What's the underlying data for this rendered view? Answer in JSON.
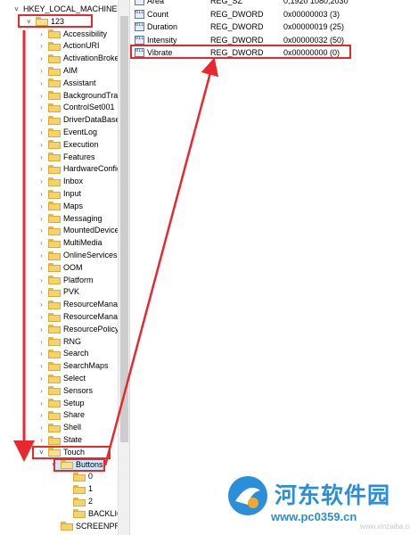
{
  "tree": {
    "root_label": "HKEY_LOCAL_MACHINE",
    "items": [
      {
        "label": "123",
        "depth": 1,
        "expanded": true
      },
      {
        "label": "Accessibility",
        "depth": 2
      },
      {
        "label": "ActionURI",
        "depth": 2
      },
      {
        "label": "ActivationBroker",
        "depth": 2
      },
      {
        "label": "AIM",
        "depth": 2
      },
      {
        "label": "Assistant",
        "depth": 2
      },
      {
        "label": "BackgroundTran",
        "depth": 2
      },
      {
        "label": "ControlSet001",
        "depth": 2
      },
      {
        "label": "DriverDataBase",
        "depth": 2
      },
      {
        "label": "EventLog",
        "depth": 2
      },
      {
        "label": "Execution",
        "depth": 2
      },
      {
        "label": "Features",
        "depth": 2
      },
      {
        "label": "HardwareConfig",
        "depth": 2
      },
      {
        "label": "Inbox",
        "depth": 2
      },
      {
        "label": "Input",
        "depth": 2
      },
      {
        "label": "Maps",
        "depth": 2
      },
      {
        "label": "Messaging",
        "depth": 2
      },
      {
        "label": "MountedDevices",
        "depth": 2
      },
      {
        "label": "MultiMedia",
        "depth": 2
      },
      {
        "label": "OnlineServices",
        "depth": 2
      },
      {
        "label": "OOM",
        "depth": 2
      },
      {
        "label": "Platform",
        "depth": 2
      },
      {
        "label": "PVK",
        "depth": 2
      },
      {
        "label": "ResourceManag",
        "depth": 2
      },
      {
        "label": "ResourceManag",
        "depth": 2
      },
      {
        "label": "ResourcePolicyS",
        "depth": 2
      },
      {
        "label": "RNG",
        "depth": 2
      },
      {
        "label": "Search",
        "depth": 2
      },
      {
        "label": "SearchMaps",
        "depth": 2
      },
      {
        "label": "Select",
        "depth": 2
      },
      {
        "label": "Sensors",
        "depth": 2
      },
      {
        "label": "Setup",
        "depth": 2
      },
      {
        "label": "Share",
        "depth": 2
      },
      {
        "label": "Shell",
        "depth": 2
      },
      {
        "label": "State",
        "depth": 2
      },
      {
        "label": "Touch",
        "depth": 2,
        "expanded": true
      },
      {
        "label": "Buttons",
        "depth": 3,
        "expanded": true,
        "selected": true
      },
      {
        "label": "0",
        "depth": 4
      },
      {
        "label": "1",
        "depth": 4
      },
      {
        "label": "2",
        "depth": 4
      },
      {
        "label": "BACKLIGH",
        "depth": 4
      },
      {
        "label": "SCREENPROF",
        "depth": 3
      }
    ]
  },
  "values": {
    "rows": [
      {
        "name": "Area",
        "type": "REG_SZ",
        "data": "0,1920 1080,2030",
        "icon": "string-value-icon"
      },
      {
        "name": "Count",
        "type": "REG_DWORD",
        "data": "0x00000003 (3)",
        "icon": "dword-value-icon"
      },
      {
        "name": "Duration",
        "type": "REG_DWORD",
        "data": "0x00000019 (25)",
        "icon": "dword-value-icon"
      },
      {
        "name": "Intensity",
        "type": "REG_DWORD",
        "data": "0x00000032 (50)",
        "icon": "dword-value-icon"
      },
      {
        "name": "Vibrate",
        "type": "REG_DWORD",
        "data": "0x00000000 (0)",
        "icon": "dword-value-icon"
      }
    ]
  },
  "watermark": {
    "title": "河东软件园",
    "url": "www.pc0359.cn",
    "faint": "www.xinzaiba.com"
  },
  "colors": {
    "annotation_red": "#e8282e",
    "selection_blue": "#cce8ff",
    "watermark_blue": "#2a8fd8",
    "folder_yellow": "#f4d36b"
  }
}
